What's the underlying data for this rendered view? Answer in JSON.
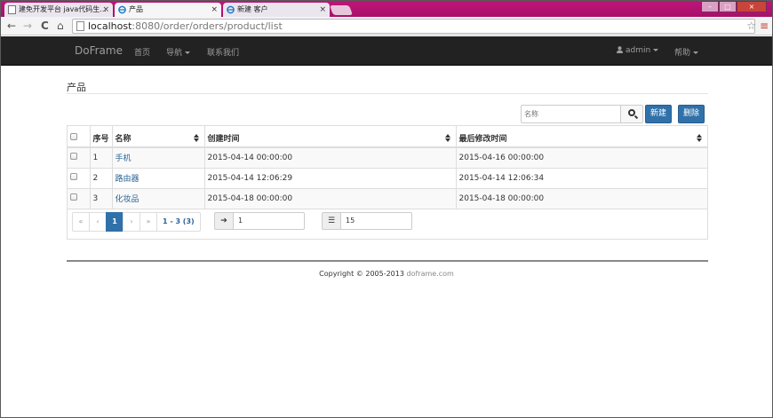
{
  "browser": {
    "tabs": [
      {
        "title": "建免开发平台 java代码生...",
        "close": "×"
      },
      {
        "title": "产品",
        "close": "×"
      },
      {
        "title": "新建 客户",
        "close": "×"
      }
    ],
    "window_controls": [
      "–",
      "□",
      "×"
    ],
    "back": "←",
    "forward": "→",
    "reload": "C",
    "home": "⌂",
    "url_host": "localhost",
    "url_path": ":8080/order/orders/product/list",
    "star": "☆",
    "menu": "≡"
  },
  "navbar": {
    "brand": "DoFrame",
    "links": [
      "首页",
      "导航",
      "联系我们"
    ],
    "user": "admin",
    "help": "帮助"
  },
  "page": {
    "title": "产品"
  },
  "search": {
    "placeholder": "名称"
  },
  "actions": {
    "new_label": "新建",
    "delete_label": "删除"
  },
  "table": {
    "columns": [
      "序号",
      "名称",
      "创建时间",
      "最后修改时间"
    ],
    "rows": [
      {
        "index": "1",
        "name": "手机",
        "created": "2015-04-14 00:00:00",
        "modified": "2015-04-16 00:00:00"
      },
      {
        "index": "2",
        "name": "路由器",
        "created": "2015-04-14 12:06:29",
        "modified": "2015-04-14 12:06:34"
      },
      {
        "index": "3",
        "name": "化妆品",
        "created": "2015-04-18 00:00:00",
        "modified": "2015-04-18 00:00:00"
      }
    ]
  },
  "pagination": {
    "first": "«",
    "prev": "‹",
    "current": "1",
    "next": "›",
    "last": "»",
    "info": "1 - 3 (3)",
    "goto_icon": "➔",
    "goto_value": "1",
    "size_icon": "☰",
    "page_size": "15"
  },
  "footer": {
    "text": "Copyright © 2005-2013 ",
    "site": "doframe.com"
  },
  "colors": {
    "titlebar": "#b0136f",
    "navbar": "#222222",
    "primary": "#3071a9",
    "link": "#2a6496"
  }
}
